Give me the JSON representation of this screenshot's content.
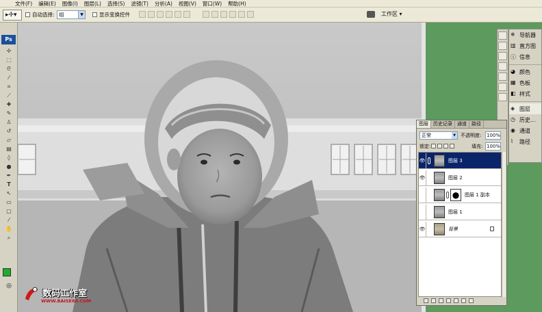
{
  "menu": {
    "items": [
      "文件(F)",
      "编辑(E)",
      "图像(I)",
      "图层(L)",
      "选择(S)",
      "滤镜(T)",
      "分析(A)",
      "视图(V)",
      "窗口(W)",
      "帮助(H)"
    ]
  },
  "options": {
    "auto_select_label": "自动选择:",
    "auto_select_value": "组",
    "show_transform_label": "显示变换控件",
    "workspace_label": "工作区 ▾"
  },
  "toolbox": {
    "logo": "Ps",
    "foreground_color": "#22aa33"
  },
  "watermark": {
    "title": "数码工作室",
    "url": "WWW.BAISE88.COM"
  },
  "dock": {
    "items": [
      "导航器",
      "直方图",
      "信息",
      "颜色",
      "色板",
      "样式",
      "图层",
      "历史...",
      "通道",
      "路径"
    ]
  },
  "layers_panel": {
    "tabs": [
      "图层",
      "历史记录",
      "通道",
      "路径"
    ],
    "blend_mode": "正常",
    "opacity_label": "不透明度:",
    "opacity_value": "100%",
    "lock_label": "锁定:",
    "fill_label": "填充:",
    "fill_value": "100%",
    "layers": [
      {
        "name": "图层 3",
        "visible": true,
        "selected": true
      },
      {
        "name": "图层 2",
        "visible": true,
        "selected": false
      },
      {
        "name": "图层 1 副本",
        "visible": false,
        "selected": false
      },
      {
        "name": "图层 1",
        "visible": false,
        "selected": false
      },
      {
        "name": "背景",
        "visible": true,
        "selected": false
      }
    ]
  },
  "colors": {
    "desktop_green": "#5c9a5e",
    "selection_blue": "#0a246a",
    "chrome": "#ece9d8"
  }
}
